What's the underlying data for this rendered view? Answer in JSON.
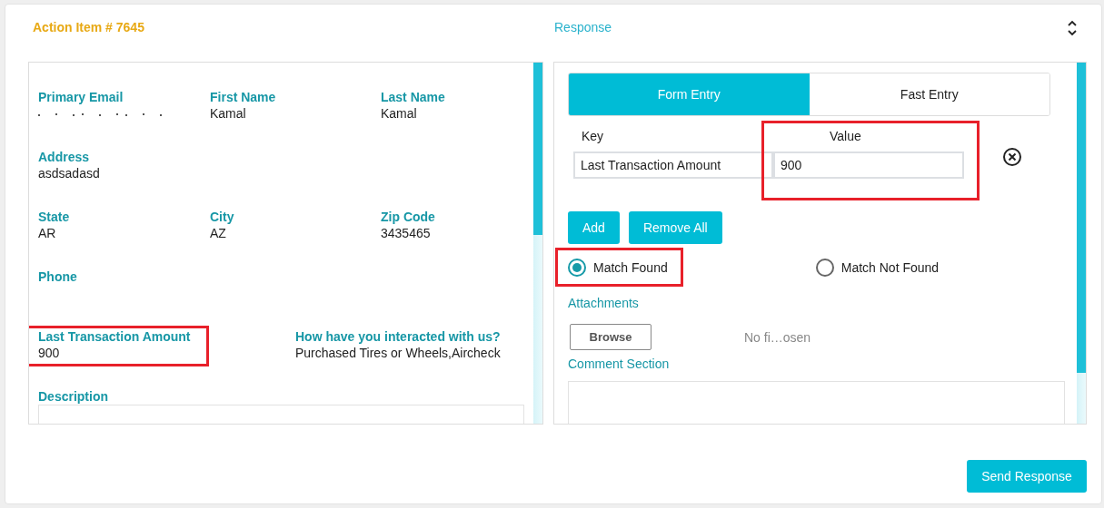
{
  "header": {
    "title": "Action Item # 7645",
    "response_title": "Response"
  },
  "customer_details": {
    "rows": [
      {
        "fields": [
          {
            "label": "Primary Email",
            "redacted": true
          },
          {
            "label": "First Name",
            "value": "Kamal"
          },
          {
            "label": "Last Name",
            "value": "Kamal"
          }
        ]
      },
      {
        "fields": [
          {
            "label": "Address",
            "value": "asdsadasd"
          }
        ]
      },
      {
        "fields": [
          {
            "label": "State",
            "value": "AR"
          },
          {
            "label": "City",
            "value": "AZ"
          },
          {
            "label": "Zip Code",
            "value": "3435465"
          }
        ]
      },
      {
        "fields": [
          {
            "label": "Phone"
          }
        ]
      },
      {
        "fields": [
          {
            "label": "Last Transaction Amount",
            "value": "900",
            "highlighted": true
          },
          {
            "label": "How have you interacted with us?",
            "value": "Purchased Tires or Wheels,Aircheck"
          }
        ]
      }
    ],
    "description": {
      "label": "Description"
    }
  },
  "response": {
    "tabs": [
      {
        "label": "Form Entry",
        "selected": true
      },
      {
        "label": "Fast Entry",
        "selected": false
      }
    ],
    "key_label": "Key",
    "value_label": "Value",
    "entries": [
      {
        "key": "Last Transaction Amount",
        "value": "900",
        "highlighted": true
      }
    ],
    "buttons": [
      "Add",
      "Remove All"
    ],
    "match_options": [
      {
        "label": "Match Found",
        "selected": true,
        "highlighted": true
      },
      {
        "label": "Match Not Found",
        "selected": false,
        "highlighted": false
      }
    ],
    "attachments": {
      "label": "Attachments",
      "button": "Browse",
      "file_status": "No fi…osen"
    },
    "comment": {
      "label": "Comment Section"
    },
    "send_button": "Send Response"
  }
}
